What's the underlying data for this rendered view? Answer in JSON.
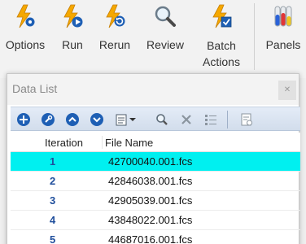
{
  "ribbon": {
    "buttons": [
      {
        "label": "Options",
        "icon": "lightning-gear-icon"
      },
      {
        "label": "Run",
        "icon": "lightning-play-icon"
      },
      {
        "label": "Rerun",
        "icon": "lightning-refresh-icon"
      },
      {
        "label": "Review",
        "icon": "magnifier-icon"
      },
      {
        "label": "Batch",
        "label2": "Actions",
        "icon": "lightning-checkbox-icon"
      },
      {
        "label": "Panels",
        "icon": "test-tubes-icon"
      }
    ]
  },
  "panel": {
    "title": "Data List",
    "close_label": "✕"
  },
  "grid": {
    "columns": [
      "Iteration",
      "File Name"
    ],
    "rows": [
      {
        "iteration": "1",
        "file": "42700040.001.fcs",
        "selected": true
      },
      {
        "iteration": "2",
        "file": "42846038.001.fcs",
        "selected": false
      },
      {
        "iteration": "3",
        "file": "42905039.001.fcs",
        "selected": false
      },
      {
        "iteration": "4",
        "file": "43848022.001.fcs",
        "selected": false
      },
      {
        "iteration": "5",
        "file": "44687016.001.fcs",
        "selected": false
      }
    ]
  },
  "colors": {
    "selection": "#00f0f0",
    "lightning": "#f5a800",
    "accent_blue": "#1e5fb4"
  }
}
